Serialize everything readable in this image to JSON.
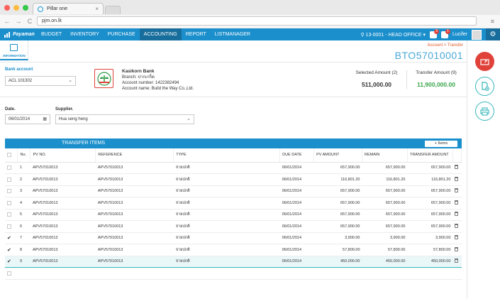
{
  "browser": {
    "tab_title": "Pillar one",
    "tab_close": "×",
    "url": "pjm.on.lk",
    "back": "←",
    "forward": "→",
    "reload": "C",
    "menu_icon": "≡"
  },
  "topbar": {
    "logo_text": "Payaman",
    "menu": [
      "BUDGET",
      "INVENTORY",
      "PURCHASE",
      "ACCOUNTING",
      "REPORT",
      "LISTMANAGER"
    ],
    "active_menu": "ACCOUNTING",
    "location": "13-0001 - HEAD OFFICE",
    "badge_1": "3",
    "badge_2": "1",
    "user": "Lucifer",
    "gear": "⚙"
  },
  "side": {
    "info_label": "INFORMATION"
  },
  "header": {
    "breadcrumb": "Account > Transfer",
    "doc_no": "BTO57010001"
  },
  "bank": {
    "label": "Bank account",
    "account": "ACL 101302",
    "name": "Kasikorn Bank",
    "branch": "Branch: ปากเกร็ด",
    "account_number": "Account number: 1422382494",
    "account_name": "Account name: Build the Way Co.,Ltd."
  },
  "amounts": {
    "selected_label": "Selected Amount (2)",
    "selected_value": "511,000.00",
    "transfer_label": "Transfer Amount (9)",
    "transfer_value": "11,900,000.00"
  },
  "form": {
    "date_label": "Date.",
    "date_value": "06/01/2014",
    "supplier_label": "Supplier.",
    "supplier_value": "Hua seng heng"
  },
  "transfer": {
    "title": "TRANSFER ITEMS",
    "add_button": "+ Items",
    "columns": [
      "No.",
      "PV NO.",
      "REFERENCE",
      "TYPE",
      "DUE DATE",
      "PV AMOUNT",
      "REMAIN",
      "TRANSFER AMOUNT"
    ],
    "rows": [
      {
        "no": "1",
        "pv": "APV57010013",
        "ref": "APV57010013",
        "type": "จ่ายปกติ",
        "due": "06/01/2014",
        "pv_amount": "657,900.00",
        "remain": "657,900.00",
        "transfer": "657,900.00",
        "checked": false
      },
      {
        "no": "2",
        "pv": "APV57010013",
        "ref": "APV57010013",
        "type": "จ่ายปกติ",
        "due": "06/01/2014",
        "pv_amount": "116,801.20",
        "remain": "116,801.20",
        "transfer": "116,801.20",
        "checked": false
      },
      {
        "no": "3",
        "pv": "APV57010013",
        "ref": "APV57010013",
        "type": "จ่ายปกติ",
        "due": "06/01/2014",
        "pv_amount": "657,900.00",
        "remain": "657,900.00",
        "transfer": "657,900.00",
        "checked": false
      },
      {
        "no": "4",
        "pv": "APV57010013",
        "ref": "APV57010013",
        "type": "จ่ายปกติ",
        "due": "06/01/2014",
        "pv_amount": "657,900.00",
        "remain": "657,900.00",
        "transfer": "657,900.00",
        "checked": false
      },
      {
        "no": "5",
        "pv": "APV57010013",
        "ref": "APV57010013",
        "type": "จ่ายปกติ",
        "due": "06/01/2014",
        "pv_amount": "657,900.00",
        "remain": "657,900.00",
        "transfer": "657,900.00",
        "checked": false
      },
      {
        "no": "6",
        "pv": "APV57010013",
        "ref": "APV57010013",
        "type": "จ่ายปกติ",
        "due": "06/01/2014",
        "pv_amount": "657,900.00",
        "remain": "657,900.00",
        "transfer": "657,900.00",
        "checked": false
      },
      {
        "no": "7",
        "pv": "APV57010013",
        "ref": "APV57010013",
        "type": "จ่ายปกติ",
        "due": "06/01/2014",
        "pv_amount": "3,900.00",
        "remain": "3,900.00",
        "transfer": "3,900.00",
        "checked": true
      },
      {
        "no": "8",
        "pv": "APV57010013",
        "ref": "APV57010013",
        "type": "จ่ายปกติ",
        "due": "06/01/2014",
        "pv_amount": "57,800.00",
        "remain": "57,800.00",
        "transfer": "57,800.00",
        "checked": true
      },
      {
        "no": "9",
        "pv": "APV57010013",
        "ref": "APV57010013",
        "type": "จ่ายปกติ",
        "due": "06/01/2014",
        "pv_amount": "450,000.00",
        "remain": "450,000.00",
        "transfer": "450,000.00",
        "checked": true
      }
    ]
  },
  "colors": {
    "primary": "#1b8fcc",
    "accent_red": "#e0423a",
    "accent_teal": "#37b6ba",
    "amount_green": "#3aa54a"
  }
}
